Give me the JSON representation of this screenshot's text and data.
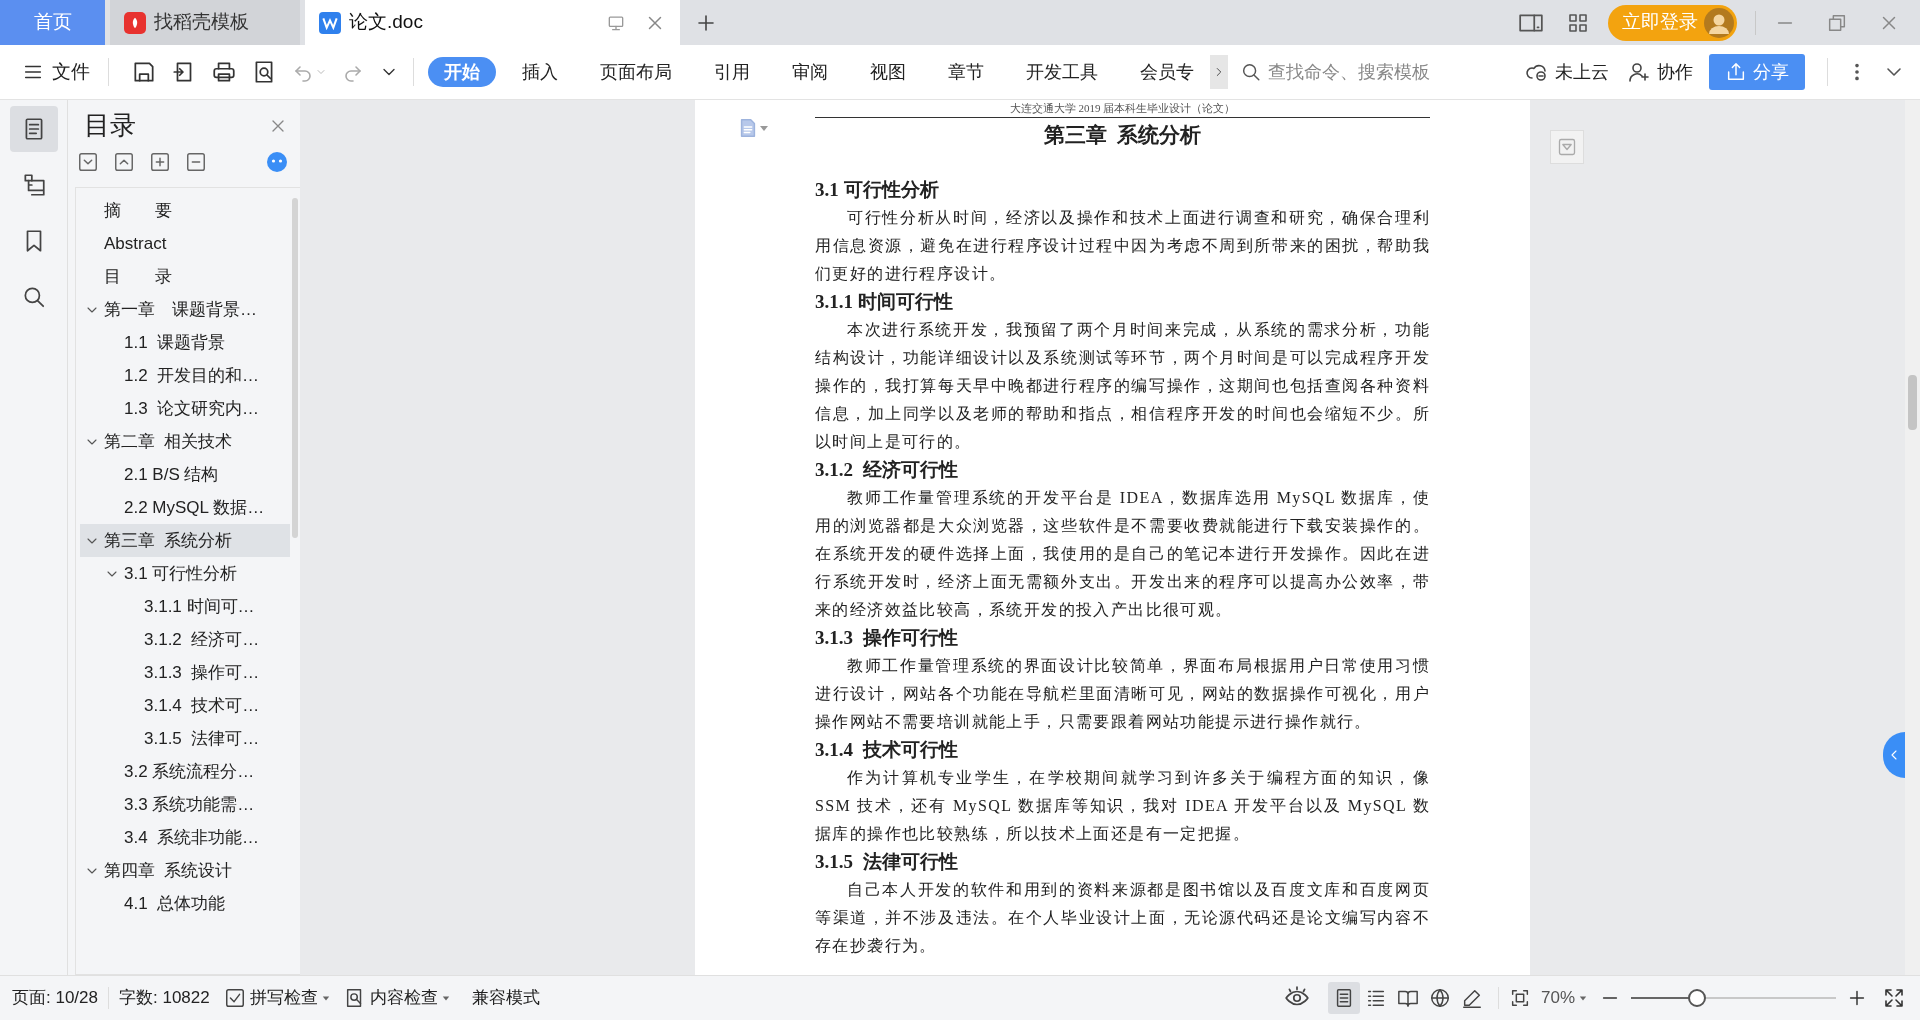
{
  "tabs": [
    {
      "label": "首页",
      "kind": "home",
      "selected": false
    },
    {
      "label": "找稻壳模板",
      "kind": "docer",
      "selected": false
    },
    {
      "label": "论文.doc",
      "kind": "doc",
      "selected": true
    }
  ],
  "account": {
    "login": "立即登录"
  },
  "toolbar": {
    "file": "文件",
    "ribbon_tabs": [
      {
        "label": "开始",
        "selected": true
      },
      {
        "label": "插入",
        "selected": false
      },
      {
        "label": "页面布局",
        "selected": false
      },
      {
        "label": "引用",
        "selected": false
      },
      {
        "label": "审阅",
        "selected": false
      },
      {
        "label": "视图",
        "selected": false
      },
      {
        "label": "章节",
        "selected": false
      },
      {
        "label": "开发工具",
        "selected": false
      },
      {
        "label": "会员专",
        "selected": false
      }
    ],
    "search": {
      "placeholder": "查找命令、搜索模板"
    },
    "cloud": "未上云",
    "collaborate": "协作",
    "share": "分享"
  },
  "side_rail": [
    {
      "kind": "toc",
      "selected": true
    },
    {
      "kind": "nav",
      "selected": false
    },
    {
      "kind": "bookmark",
      "selected": false
    },
    {
      "kind": "search",
      "selected": false
    }
  ],
  "toc": {
    "title": "目录",
    "items": [
      {
        "label": "摘　　要",
        "selected": false
      },
      {
        "label": "Abstract",
        "selected": false
      },
      {
        "label": "目　　录",
        "selected": false
      },
      {
        "label": "第一章　课题背景…",
        "selected": false,
        "expanded": true,
        "children": [
          {
            "label": "1.1  课题背景",
            "selected": false
          },
          {
            "label": "1.2  开发目的和…",
            "selected": false
          },
          {
            "label": "1.3  论文研究内…",
            "selected": false
          }
        ]
      },
      {
        "label": "第二章  相关技术",
        "selected": false,
        "expanded": true,
        "children": [
          {
            "label": "2.1 B/S 结构",
            "selected": false
          },
          {
            "label": "2.2 MySQL 数据…",
            "selected": false
          }
        ]
      },
      {
        "label": "第三章  系统分析",
        "selected": true,
        "expanded": true,
        "children": [
          {
            "label": "3.1 可行性分析",
            "selected": false,
            "expanded": true,
            "children": [
              {
                "label": "3.1.1 时间可…",
                "selected": false
              },
              {
                "label": "3.1.2  经济可…",
                "selected": false
              },
              {
                "label": "3.1.3  操作可…",
                "selected": false
              },
              {
                "label": "3.1.4  技术可…",
                "selected": false
              },
              {
                "label": "3.1.5  法律可…",
                "selected": false
              }
            ]
          },
          {
            "label": "3.2 系统流程分…",
            "selected": false
          },
          {
            "label": "3.3 系统功能需…",
            "selected": false
          },
          {
            "label": "3.4  系统非功能…",
            "selected": false
          }
        ]
      },
      {
        "label": "第四章  系统设计",
        "selected": false,
        "expanded": true,
        "children": [
          {
            "label": "4.1  总体功能",
            "selected": false
          }
        ]
      }
    ]
  },
  "document": {
    "header": "大连交通大学 2019 届本科生毕业设计（论文）",
    "chapter_title": "第三章  系统分析",
    "blocks": [
      {
        "kind": "h2",
        "text": "3.1 可行性分析"
      },
      {
        "kind": "p",
        "text": "可行性分析从时间，经济以及操作和技术上面进行调查和研究，确保合理利用信息资源，避免在进行程序设计过程中因为考虑不周到所带来的困扰，帮助我们更好的进行程序设计。"
      },
      {
        "kind": "h3",
        "text": "3.1.1 时间可行性"
      },
      {
        "kind": "p",
        "text": "本次进行系统开发，我预留了两个月时间来完成，从系统的需求分析，功能结构设计，功能详细设计以及系统测试等环节，两个月时间是可以完成程序开发操作的，我打算每天早中晚都进行程序的编写操作，这期间也包括查阅各种资料信息，加上同学以及老师的帮助和指点，相信程序开发的时间也会缩短不少。所以时间上是可行的。"
      },
      {
        "kind": "h3",
        "text": "3.1.2  经济可行性"
      },
      {
        "kind": "p",
        "text": "教师工作量管理系统的开发平台是 IDEA，数据库选用 MySQL 数据库，使用的浏览器都是大众浏览器，这些软件是不需要收费就能进行下载安装操作的。在系统开发的硬件选择上面，我使用的是自己的笔记本进行开发操作。因此在进行系统开发时，经济上面无需额外支出。开发出来的程序可以提高办公效率，带来的经济效益比较高，系统开发的投入产出比很可观。"
      },
      {
        "kind": "h3",
        "text": "3.1.3  操作可行性"
      },
      {
        "kind": "p",
        "text": "教师工作量管理系统的界面设计比较简单，界面布局根据用户日常使用习惯进行设计，网站各个功能在导航栏里面清晰可见，网站的数据操作可视化，用户操作网站不需要培训就能上手，只需要跟着网站功能提示进行操作就行。"
      },
      {
        "kind": "h3",
        "text": "3.1.4  技术可行性"
      },
      {
        "kind": "p",
        "text": "作为计算机专业学生，在学校期间就学习到许多关于编程方面的知识，像 SSM 技术，还有 MySQL 数据库等知识，我对 IDEA 开发平台以及 MySQL 数据库的操作也比较熟练，所以技术上面还是有一定把握。"
      },
      {
        "kind": "h3",
        "text": "3.1.5  法律可行性"
      },
      {
        "kind": "p",
        "text": "自己本人开发的软件和用到的资料来源都是图书馆以及百度文库和百度网页等渠道，并不涉及违法。在个人毕业设计上面，无论源代码还是论文编写内容不存在抄袭行为。"
      }
    ]
  },
  "status_bar": {
    "page": "页面: 10/28",
    "words": "字数: 10822",
    "spell_check": "拼写检查",
    "content_check": "内容检查",
    "mode": "兼容模式",
    "views": [
      {
        "kind": "page",
        "selected": true
      },
      {
        "kind": "outline",
        "selected": false
      },
      {
        "kind": "read",
        "selected": false
      },
      {
        "kind": "web",
        "selected": false
      },
      {
        "kind": "write",
        "selected": false
      }
    ],
    "zoom": "70%",
    "zoom_slider": {
      "level": 0.32
    }
  }
}
